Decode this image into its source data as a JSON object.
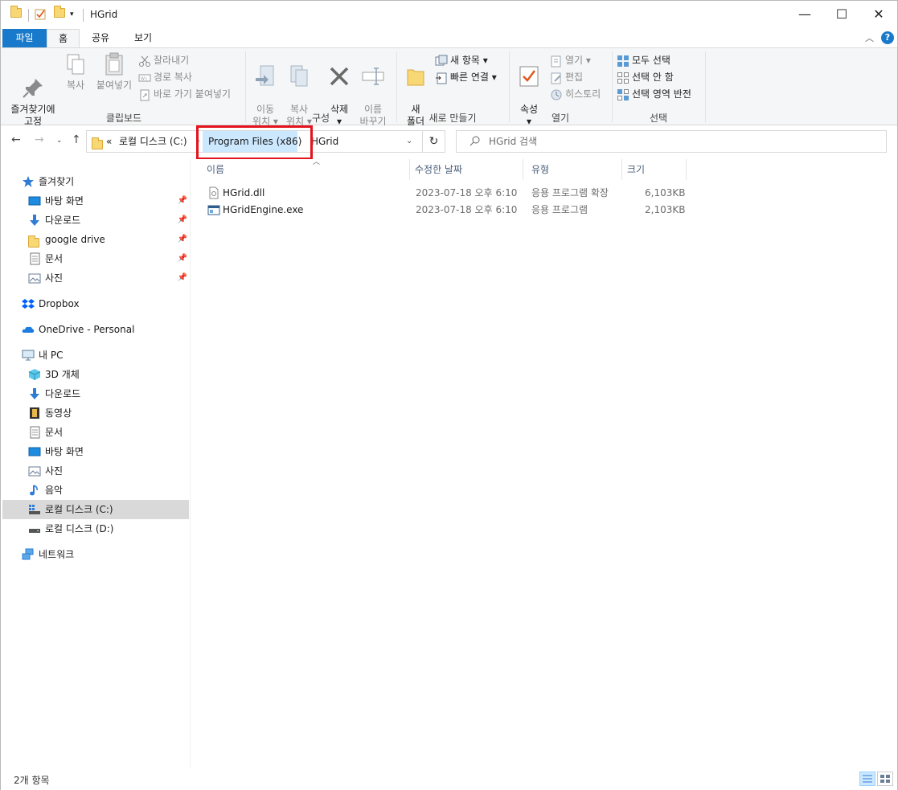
{
  "window": {
    "title": "HGrid",
    "controls": {
      "minimize": "—",
      "maximize": "☐",
      "close": "✕"
    }
  },
  "ribbon_tabs": [
    "파일",
    "홈",
    "공유",
    "보기"
  ],
  "ribbon": {
    "clipboard": {
      "label": "클립보드",
      "pin": "즐겨찾기에\n고정",
      "copy": "복사",
      "paste": "붙여넣기",
      "cut": "잘라내기",
      "copy_path": "경로 복사",
      "paste_shortcut": "바로 가기 붙여넣기"
    },
    "organize": {
      "label": "구성",
      "move_to": "이동\n위치 ▾",
      "copy_to": "복사\n위치 ▾",
      "delete": "삭제\n▾",
      "rename": "이름\n바꾸기"
    },
    "new": {
      "label": "새로 만들기",
      "new_folder": "새\n폴더",
      "new_item": "새 항목 ▾",
      "easy_access": "빠른 연결 ▾"
    },
    "open": {
      "label": "열기",
      "properties": "속성\n▾",
      "open": "열기 ▾",
      "edit": "편집",
      "history": "히스토리"
    },
    "select": {
      "label": "선택",
      "select_all": "모두 선택",
      "select_none": "선택 안 함",
      "invert": "선택 영역 반전"
    }
  },
  "address": {
    "overflow": "«",
    "crumbs": [
      "로컬 디스크 (C:)",
      "Program Files (x86)",
      "HGrid"
    ],
    "search_placeholder": "HGrid 검색"
  },
  "nav": {
    "quick_access": {
      "label": "즐겨찾기",
      "items": [
        "바탕 화면",
        "다운로드",
        "google drive",
        "문서",
        "사진"
      ]
    },
    "dropbox": "Dropbox",
    "onedrive": "OneDrive - Personal",
    "this_pc": {
      "label": "내 PC",
      "items": [
        "3D 개체",
        "다운로드",
        "동영상",
        "문서",
        "바탕 화면",
        "사진",
        "음악",
        "로컬 디스크 (C:)",
        "로컬 디스크 (D:)"
      ]
    },
    "network": "네트워크"
  },
  "columns": [
    "이름",
    "수정한 날짜",
    "유형",
    "크기"
  ],
  "files": [
    {
      "name": "HGrid.dll",
      "date": "2023-07-18 오후 6:10",
      "type": "응용 프로그램 확장",
      "size": "6,103KB"
    },
    {
      "name": "HGridEngine.exe",
      "date": "2023-07-18 오후 6:10",
      "type": "응용 프로그램",
      "size": "2,103KB"
    }
  ],
  "status": {
    "count": "2개 항목"
  }
}
